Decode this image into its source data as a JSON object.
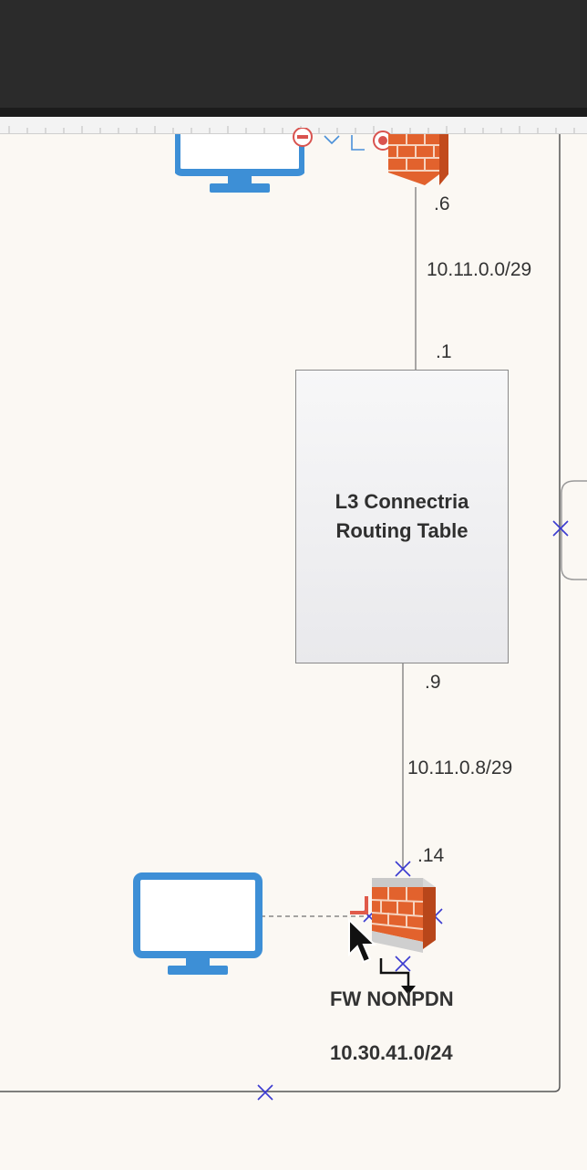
{
  "diagram": {
    "top_interface": ".6",
    "upper_subnet": "10.11.0.0/29",
    "router_upper_interface": ".1",
    "router": {
      "line1": "L3 Connectria",
      "line2": "Routing Table"
    },
    "router_lower_interface": ".9",
    "lower_subnet": "10.11.0.8/29",
    "firewall_interface": ".14",
    "firewall_name": "FW NONPDN",
    "firewall_network": "10.30.41.0/24"
  },
  "colors": {
    "monitor": "#3d8fd6",
    "firewall_brick": "#e2622d",
    "selection_handle": "#3b3bd0",
    "connector": "#707070"
  },
  "icons": [
    "monitor-icon",
    "firewall-icon",
    "delete-icon",
    "chevron-down-icon",
    "cursor-icon",
    "connector-arrow-icon",
    "resize-handle-icon"
  ]
}
